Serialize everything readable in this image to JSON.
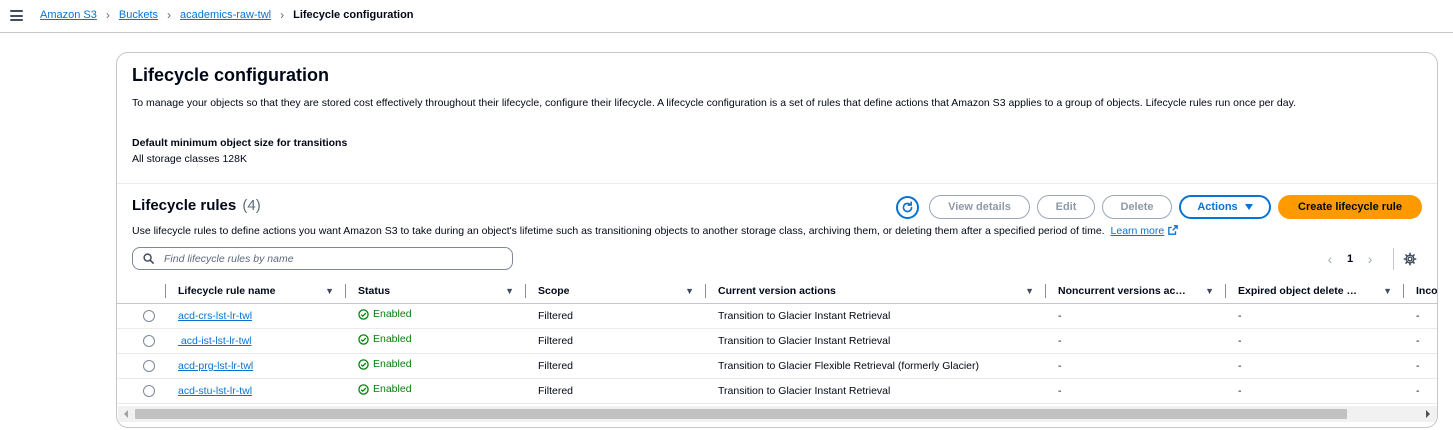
{
  "breadcrumbs": {
    "items": [
      "Amazon S3",
      "Buckets",
      "academics-raw-twl"
    ],
    "current": "Lifecycle configuration"
  },
  "page": {
    "title": "Lifecycle configuration",
    "description": "To manage your objects so that they are stored cost effectively throughout their lifecycle, configure their lifecycle. A lifecycle configuration is a set of rules that define actions that Amazon S3 applies to a group of objects. Lifecycle rules run once per day.",
    "min_size_label": "Default minimum object size for transitions",
    "min_size_value": "All storage classes 128K"
  },
  "rules": {
    "title": "Lifecycle rules",
    "count": "(4)",
    "description": "Use lifecycle rules to define actions you want Amazon S3 to take during an object's lifetime such as transitioning objects to another storage class, archiving them, or deleting them after a specified period of time.",
    "learn_more": "Learn more",
    "buttons": {
      "view_details": "View details",
      "edit": "Edit",
      "delete": "Delete",
      "actions": "Actions",
      "create": "Create lifecycle rule"
    },
    "search_placeholder": "Find lifecycle rules by name",
    "current_page": "1",
    "columns": [
      "Lifecycle rule name",
      "Status",
      "Scope",
      "Current version actions",
      "Noncurrent versions ac…",
      "Expired object delete …",
      "Inco"
    ],
    "rows": [
      {
        "name": "acd-crs-lst-lr-twl",
        "status": "Enabled",
        "scope": "Filtered",
        "current": "Transition to Glacier Instant Retrieval",
        "noncurrent": "-",
        "expired": "-",
        "inco": "-"
      },
      {
        "name": " acd-ist-lst-lr-twl",
        "status": "Enabled",
        "scope": "Filtered",
        "current": "Transition to Glacier Instant Retrieval",
        "noncurrent": "-",
        "expired": "-",
        "inco": "-"
      },
      {
        "name": "acd-prg-lst-lr-twl",
        "status": "Enabled",
        "scope": "Filtered",
        "current": "Transition to Glacier Flexible Retrieval (formerly Glacier)",
        "noncurrent": "-",
        "expired": "-",
        "inco": "-"
      },
      {
        "name": "acd-stu-lst-lr-twl",
        "status": "Enabled",
        "scope": "Filtered",
        "current": "Transition to Glacier Instant Retrieval",
        "noncurrent": "-",
        "expired": "-",
        "inco": "-"
      }
    ]
  },
  "colors": {
    "link": "#0972d3",
    "primary": "#ff9900",
    "success": "#037f0c"
  },
  "icons": {
    "menu": "hamburger-icon",
    "refresh": "refresh-icon",
    "search": "search-icon",
    "external": "external-link-icon",
    "settings": "gear-icon",
    "status": "check-circle-icon"
  }
}
